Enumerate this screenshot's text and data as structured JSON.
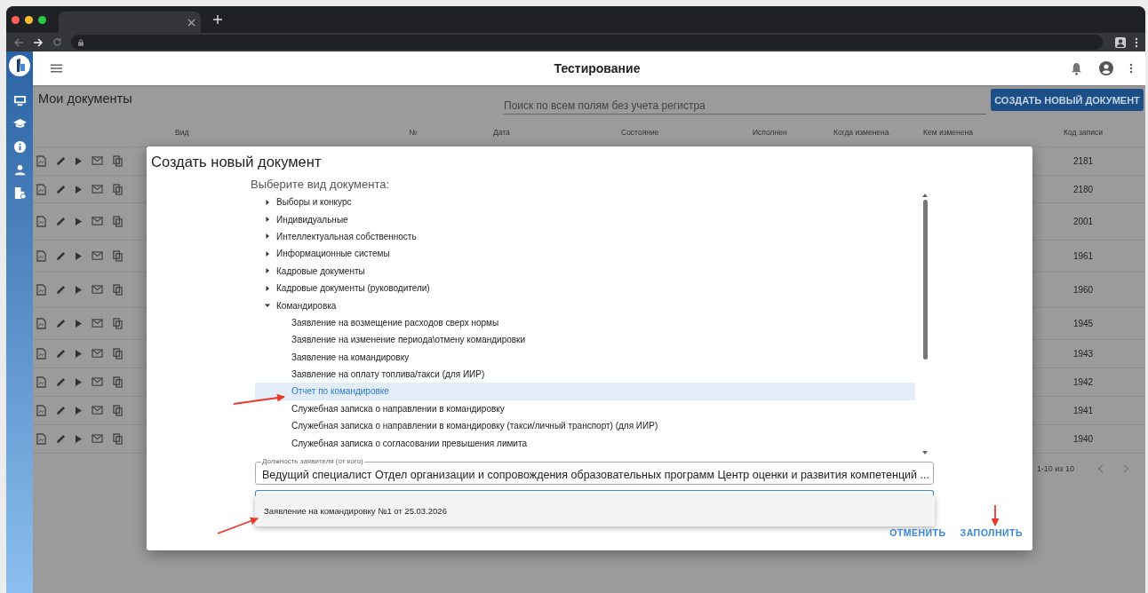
{
  "app_bar": {
    "title": "Тестирование"
  },
  "page": {
    "title": "Мои документы",
    "search": {
      "placeholder": "Поиск по всем полям без учета регистра"
    },
    "create_button": "СОЗДАТЬ НОВЫЙ ДОКУМЕНТ"
  },
  "table": {
    "columns": [
      "Вид",
      "№",
      "Дата",
      "Состояние",
      "Исполнен",
      "Когда изменена",
      "Кем изменена",
      "Код записи"
    ],
    "rows": [
      {
        "record_code": "2181"
      },
      {
        "record_code": "2180"
      },
      {
        "record_code": "2001"
      },
      {
        "record_code": "1961"
      },
      {
        "record_code": "1960"
      },
      {
        "record_code": "1945"
      },
      {
        "record_code": "1943"
      },
      {
        "record_code": "1942"
      },
      {
        "record_code": "1941"
      },
      {
        "record_code": "1940"
      }
    ]
  },
  "pagination": {
    "range": "1-10 из 10"
  },
  "dialog": {
    "title": "Создать новый документ",
    "prompt": "Выберите вид документа:",
    "tree": [
      {
        "label": "Выборы и конкурс",
        "expanded": false,
        "selected": false
      },
      {
        "label": "Индивидуальные",
        "expanded": false,
        "selected": false
      },
      {
        "label": "Интеллектуальная собственность",
        "expanded": false,
        "selected": false
      },
      {
        "label": "Информационные системы",
        "expanded": false,
        "selected": false
      },
      {
        "label": "Кадровые документы",
        "expanded": false,
        "selected": false
      },
      {
        "label": "Кадровые документы (руководители)",
        "expanded": false,
        "selected": false
      },
      {
        "label": "Командировка",
        "expanded": true,
        "selected": false,
        "children": [
          {
            "label": "Заявление на возмещение расходов сверх нормы",
            "selected": false
          },
          {
            "label": "Заявление на изменение периода\\отмену командировки",
            "selected": false
          },
          {
            "label": "Заявление на командировку",
            "selected": false
          },
          {
            "label": "Заявление на оплату топлива/такси (для ИИР)",
            "selected": false
          },
          {
            "label": "Отчет по командировке",
            "selected": true
          },
          {
            "label": "Служебная записка о направлении в командировку",
            "selected": false
          },
          {
            "label": "Служебная записка о направлении в командировку (такси/личный транспорт) (для ИИР)",
            "selected": false
          },
          {
            "label": "Служебная записка о согласовании превышения лимита",
            "selected": false
          }
        ]
      }
    ],
    "position_field": {
      "label": "Должность заявителя (от кого)",
      "value": "Ведущий специалист Отдел организации и сопровождения образовательных программ Центр оценки и развития компетенций ..."
    },
    "dropdown": {
      "options": [
        {
          "label": "Заявление на командировку №1 от 25.03.2026"
        }
      ]
    },
    "buttons": [
      "ОТМЕНИТЬ",
      "ЗАПОЛНИТЬ"
    ]
  }
}
